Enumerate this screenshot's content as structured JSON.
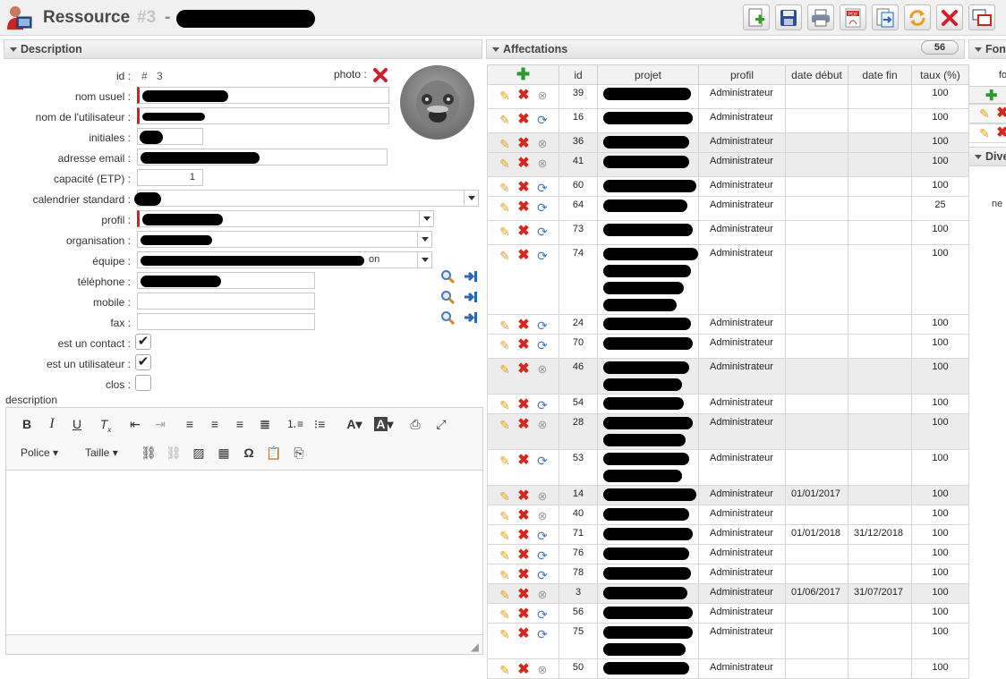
{
  "header": {
    "title": "Ressource",
    "record_number": "#3",
    "separator": "-",
    "toolbar": [
      {
        "name": "new-button",
        "icon": "new-document-icon",
        "color": "#3a9a2a"
      },
      {
        "name": "save-button",
        "icon": "floppy-disk-icon",
        "color": "#2d4f8a"
      },
      {
        "name": "print-button",
        "icon": "printer-icon",
        "color": "#5a6a88"
      },
      {
        "name": "pdf-button",
        "icon": "pdf-icon",
        "color": "#c9271e"
      },
      {
        "name": "export-button",
        "icon": "export-icon",
        "color": "#2a66b8"
      },
      {
        "name": "refresh-button",
        "icon": "refresh-icon",
        "color": "#e8a020"
      },
      {
        "name": "close-button",
        "icon": "close-icon",
        "color": "#d41e2a"
      },
      {
        "name": "window-button",
        "icon": "window-icon",
        "color": "#c9271e"
      }
    ]
  },
  "description": {
    "section_title": "Description",
    "id_label": "id :",
    "id_prefix": "#",
    "id_value": "3",
    "photo_label": "photo :",
    "fields": {
      "nom_usuel": "nom usuel :",
      "nom_utilisateur": "nom de l'utilisateur :",
      "initiales": "initiales :",
      "email": "adresse email :",
      "capacite": "capacité (ETP) :",
      "capacite_value": "1",
      "calendrier": "calendrier standard :",
      "profil": "profil :",
      "organisation": "organisation :",
      "equipe": "équipe :",
      "equipe_suffix": "on",
      "telephone": "téléphone :",
      "mobile": "mobile :",
      "fax": "fax :",
      "contact": "est un contact :",
      "utilisateur": "est un utilisateur :",
      "clos": "clos :"
    },
    "checkboxes": {
      "contact": true,
      "utilisateur": true,
      "clos": false
    },
    "description_label": "description",
    "editor": {
      "police": "Police",
      "taille": "Taille"
    }
  },
  "affectations": {
    "section_title": "Affectations",
    "count": "56",
    "columns": [
      "id",
      "projet",
      "profil",
      "date début",
      "date fin",
      "taux (%)"
    ],
    "rows": [
      {
        "id": "39",
        "profil": "Administrateur",
        "debut": "",
        "fin": "",
        "taux": "100",
        "alt": false,
        "closed": true,
        "h": 27
      },
      {
        "id": "16",
        "profil": "Administrateur",
        "debut": "",
        "fin": "",
        "taux": "100",
        "alt": false,
        "closed": false,
        "h": 27
      },
      {
        "id": "36",
        "profil": "Administrateur",
        "debut": "",
        "fin": "",
        "taux": "100",
        "alt": true,
        "closed": true,
        "h": 22
      },
      {
        "id": "41",
        "profil": "Administrateur",
        "debut": "",
        "fin": "",
        "taux": "100",
        "alt": true,
        "closed": true,
        "h": 27
      },
      {
        "id": "60",
        "profil": "Administrateur",
        "debut": "",
        "fin": "",
        "taux": "100",
        "alt": false,
        "closed": false,
        "h": 21
      },
      {
        "id": "64",
        "profil": "Administrateur",
        "debut": "",
        "fin": "",
        "taux": "25",
        "alt": false,
        "closed": false,
        "h": 27
      },
      {
        "id": "73",
        "profil": "Administrateur",
        "debut": "",
        "fin": "",
        "taux": "100",
        "alt": false,
        "closed": false,
        "h": 27
      },
      {
        "id": "74",
        "profil": "Administrateur",
        "debut": "",
        "fin": "",
        "taux": "100",
        "alt": false,
        "closed": false,
        "h": 63
      },
      {
        "id": "24",
        "profil": "Administrateur",
        "debut": "",
        "fin": "",
        "taux": "100",
        "alt": false,
        "closed": false,
        "h": 21
      },
      {
        "id": "70",
        "profil": "Administrateur",
        "debut": "",
        "fin": "",
        "taux": "100",
        "alt": false,
        "closed": false,
        "h": 27
      },
      {
        "id": "46",
        "profil": "Administrateur",
        "debut": "",
        "fin": "",
        "taux": "100",
        "alt": true,
        "closed": true,
        "h": 39
      },
      {
        "id": "54",
        "profil": "Administrateur",
        "debut": "",
        "fin": "",
        "taux": "100",
        "alt": false,
        "closed": false,
        "h": 21
      },
      {
        "id": "28",
        "profil": "Administrateur",
        "debut": "",
        "fin": "",
        "taux": "100",
        "alt": true,
        "closed": true,
        "h": 39
      },
      {
        "id": "53",
        "profil": "Administrateur",
        "debut": "",
        "fin": "",
        "taux": "100",
        "alt": false,
        "closed": false,
        "h": 39
      },
      {
        "id": "14",
        "profil": "Administrateur",
        "debut": "01/01/2017",
        "fin": "",
        "taux": "100",
        "alt": true,
        "closed": true,
        "h": 22
      },
      {
        "id": "40",
        "profil": "Administrateur",
        "debut": "",
        "fin": "",
        "taux": "100",
        "alt": false,
        "closed": true,
        "h": 21
      },
      {
        "id": "71",
        "profil": "Administrateur",
        "debut": "01/01/2018",
        "fin": "31/12/2018",
        "taux": "100",
        "alt": false,
        "closed": false,
        "h": 21
      },
      {
        "id": "76",
        "profil": "Administrateur",
        "debut": "",
        "fin": "",
        "taux": "100",
        "alt": false,
        "closed": false,
        "h": 21
      },
      {
        "id": "78",
        "profil": "Administrateur",
        "debut": "",
        "fin": "",
        "taux": "100",
        "alt": false,
        "closed": false,
        "h": 21
      },
      {
        "id": "3",
        "profil": "Administrateur",
        "debut": "01/06/2017",
        "fin": "31/07/2017",
        "taux": "100",
        "alt": true,
        "closed": true,
        "h": 22
      },
      {
        "id": "56",
        "profil": "Administrateur",
        "debut": "",
        "fin": "",
        "taux": "100",
        "alt": false,
        "closed": false,
        "h": 21
      },
      {
        "id": "75",
        "profil": "Administrateur",
        "debut": "",
        "fin": "",
        "taux": "100",
        "alt": false,
        "closed": false,
        "h": 39
      },
      {
        "id": "50",
        "profil": "Administrateur",
        "debut": "",
        "fin": "",
        "taux": "100",
        "alt": false,
        "closed": true,
        "h": 22
      }
    ]
  },
  "right_panel": {
    "section1": "Fonc",
    "label_fo": "fo",
    "section2": "Dive",
    "label_ne": "ne"
  }
}
